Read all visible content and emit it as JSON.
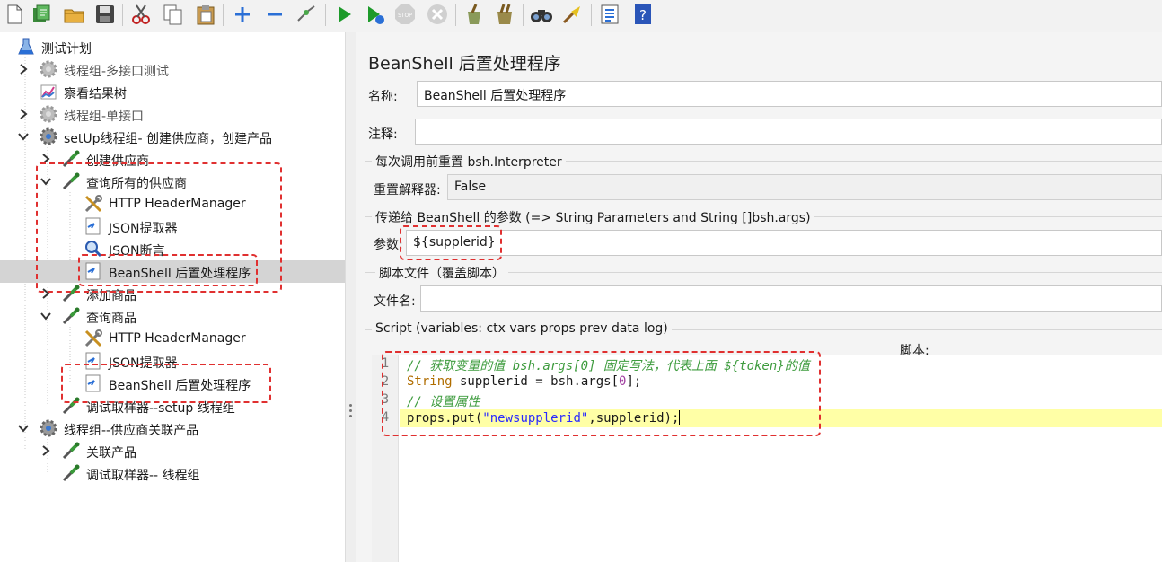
{
  "toolbar": {
    "icons": [
      "new-icon",
      "templates-icon",
      "open-icon",
      "save-icon",
      "cut-icon",
      "copy-icon",
      "paste-icon",
      "expand-icon",
      "collapse-icon",
      "toggle-icon",
      "start-icon",
      "start-no-pause-icon",
      "stop-icon",
      "shutdown-icon",
      "clear-icon",
      "clear-all-icon",
      "search-icon",
      "reset-search-icon",
      "function-helper-icon",
      "help-icon"
    ]
  },
  "tree": {
    "items": [
      {
        "label": "测试计划",
        "icon": "flask-icon",
        "depth": 0,
        "arrow": "",
        "dim": false
      },
      {
        "label": "线程组-多接口测试",
        "icon": "gear-disabled-icon",
        "depth": 1,
        "arrow": "right",
        "dim": true
      },
      {
        "label": "察看结果树",
        "icon": "chart-icon",
        "depth": 1,
        "arrow": "",
        "dim": false
      },
      {
        "label": "线程组-单接口",
        "icon": "gear-disabled-icon",
        "depth": 1,
        "arrow": "right",
        "dim": true
      },
      {
        "label": "setUp线程组- 创建供应商，创建产品",
        "icon": "gear-icon",
        "depth": 1,
        "arrow": "down",
        "dim": false
      },
      {
        "label": "创建供应商",
        "icon": "pipette-icon",
        "depth": 2,
        "arrow": "right",
        "dim": false
      },
      {
        "label": "查询所有的供应商",
        "icon": "pipette-icon",
        "depth": 2,
        "arrow": "down",
        "dim": false
      },
      {
        "label": "HTTP HeaderManager",
        "icon": "tools-icon",
        "depth": 3,
        "arrow": "",
        "dim": false
      },
      {
        "label": "JSON提取器",
        "icon": "script-icon",
        "depth": 3,
        "arrow": "",
        "dim": false
      },
      {
        "label": "JSON断言",
        "icon": "magnifier-icon",
        "depth": 3,
        "arrow": "",
        "dim": false
      },
      {
        "label": "BeanShell 后置处理程序",
        "icon": "script-icon",
        "depth": 3,
        "arrow": "",
        "dim": false,
        "selected": true
      },
      {
        "label": "添加商品",
        "icon": "pipette-icon",
        "depth": 2,
        "arrow": "right",
        "dim": false
      },
      {
        "label": "查询商品",
        "icon": "pipette-icon",
        "depth": 2,
        "arrow": "down",
        "dim": false
      },
      {
        "label": "HTTP HeaderManager",
        "icon": "tools-icon",
        "depth": 3,
        "arrow": "",
        "dim": false
      },
      {
        "label": "JSON提取器",
        "icon": "script-icon",
        "depth": 3,
        "arrow": "",
        "dim": false
      },
      {
        "label": "BeanShell 后置处理程序",
        "icon": "script-icon",
        "depth": 3,
        "arrow": "",
        "dim": false
      },
      {
        "label": "调试取样器--setup 线程组",
        "icon": "pipette-icon",
        "depth": 2,
        "arrow": "",
        "dim": false
      },
      {
        "label": "线程组--供应商关联产品",
        "icon": "gear-icon",
        "depth": 1,
        "arrow": "down",
        "dim": false
      },
      {
        "label": "关联产品",
        "icon": "pipette-icon",
        "depth": 2,
        "arrow": "right",
        "dim": false
      },
      {
        "label": "调试取样器-- 线程组",
        "icon": "pipette-icon",
        "depth": 2,
        "arrow": "",
        "dim": false
      }
    ]
  },
  "panel": {
    "title": "BeanShell 后置处理程序",
    "name_label": "名称:",
    "name_value": "BeanShell 后置处理程序",
    "comment_label": "注释:",
    "comment_value": "",
    "reset_group_title": "每次调用前重置 bsh.Interpreter",
    "reset_label": "重置解释器:",
    "reset_value": "False",
    "params_group_title": "传递给 BeanShell 的参数 (=> String Parameters and String []bsh.args)",
    "params_label": "参数:",
    "params_value": "${supplerid}",
    "file_group_title": "脚本文件（覆盖脚本）",
    "file_label": "文件名:",
    "file_value": "",
    "script_group_title": "Script (variables: ctx vars props prev data log)",
    "script_label": "脚本:",
    "line_numbers": [
      "1",
      "2",
      "3",
      "4"
    ]
  },
  "code": {
    "line1": "// 获取变量的值 bsh.args[0] 固定写法，代表上面 ${token}的值",
    "line2_type": "String",
    "line2_a": " supplerid = bsh.args[",
    "line2_num": "0",
    "line2_b": "];",
    "line3": "// 设置属性",
    "line4_a": "props.put(",
    "line4_str": "\"newsupplerid\"",
    "line4_b": ",supplerid);"
  },
  "annotation_color": "#e03030"
}
